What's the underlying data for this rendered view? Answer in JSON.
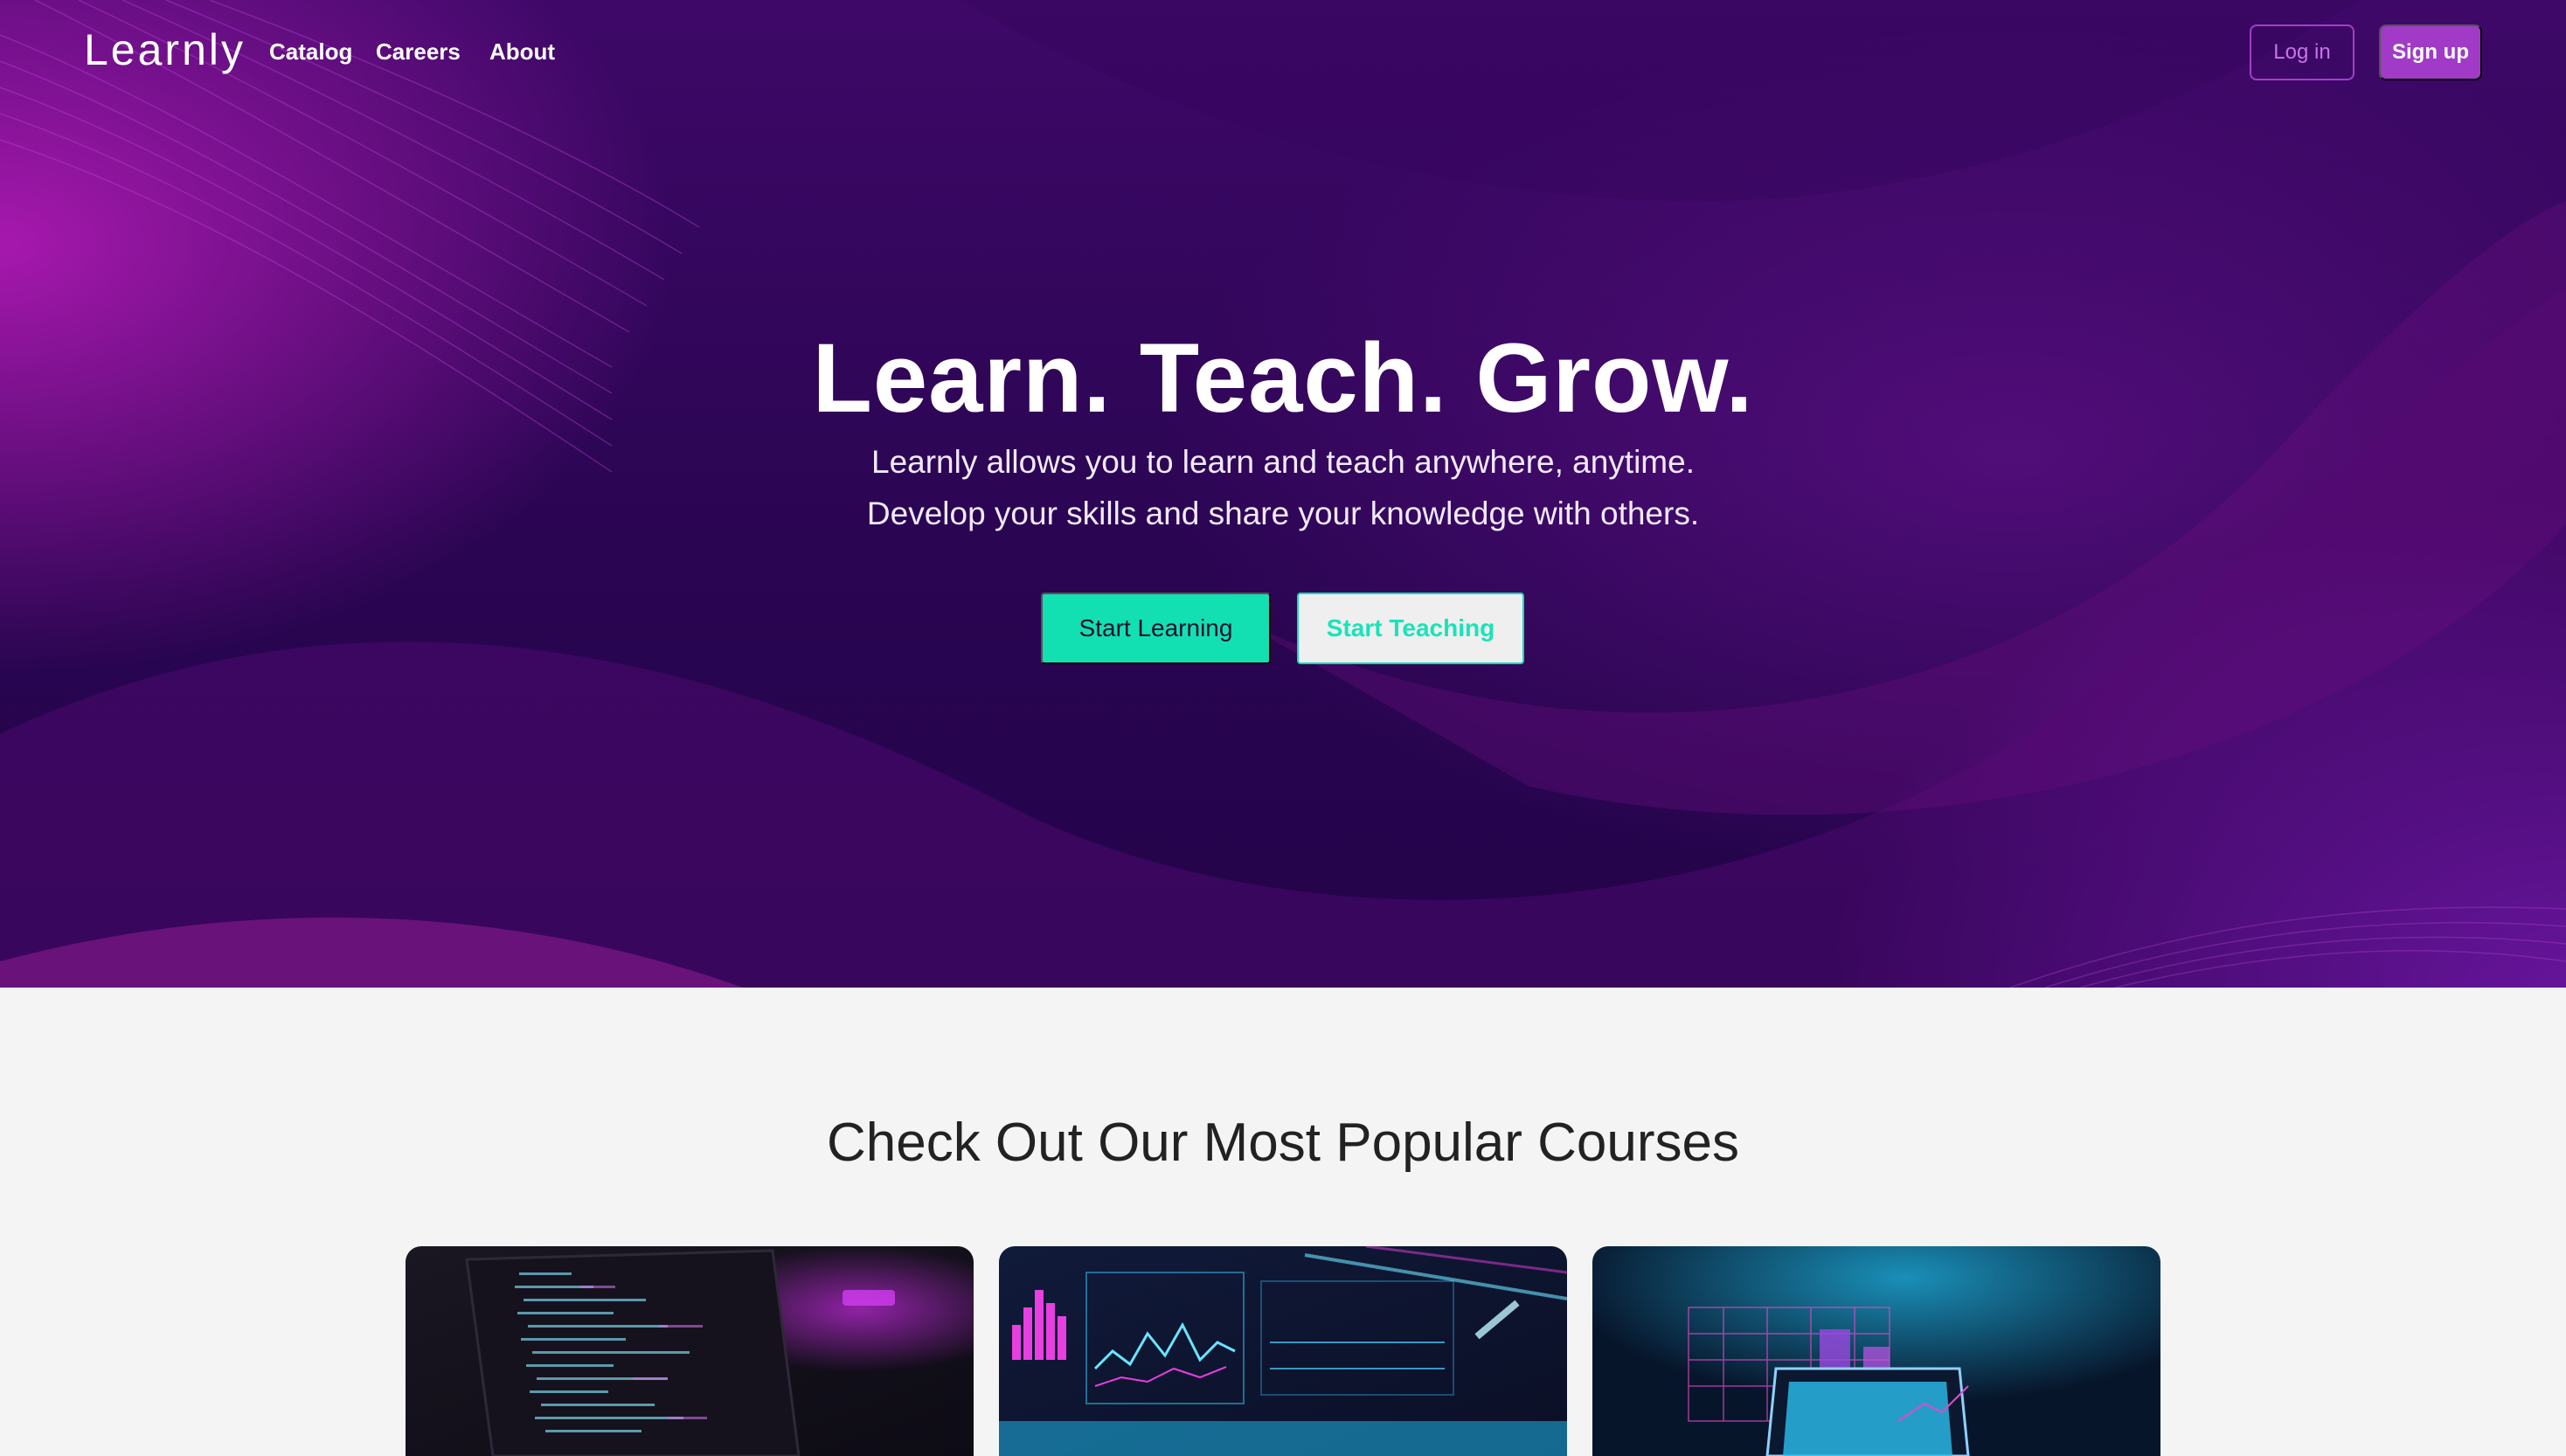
{
  "nav": {
    "logo": "Learnly",
    "links": [
      "Catalog",
      "Careers",
      "About"
    ],
    "login_label": "Log in",
    "signup_label": "Sign up"
  },
  "hero": {
    "title": "Learn. Teach. Grow.",
    "subtitle_line1": "Learnly allows you to learn and teach anywhere, anytime.",
    "subtitle_line2": "Develop your skills and share your knowledge with others.",
    "primary_cta": "Start Learning",
    "secondary_cta": "Start Teaching"
  },
  "courses": {
    "heading": "Check Out Our Most Popular Courses",
    "cards": [
      {
        "image": "code-editor-laptop"
      },
      {
        "image": "analytics-dashboard"
      },
      {
        "image": "laptop-3d-charts"
      }
    ]
  },
  "colors": {
    "accent": "#12e0b2",
    "brand": "#a13ac7",
    "hero_bg": "#2a0552",
    "page_bg": "#f4f4f5"
  }
}
